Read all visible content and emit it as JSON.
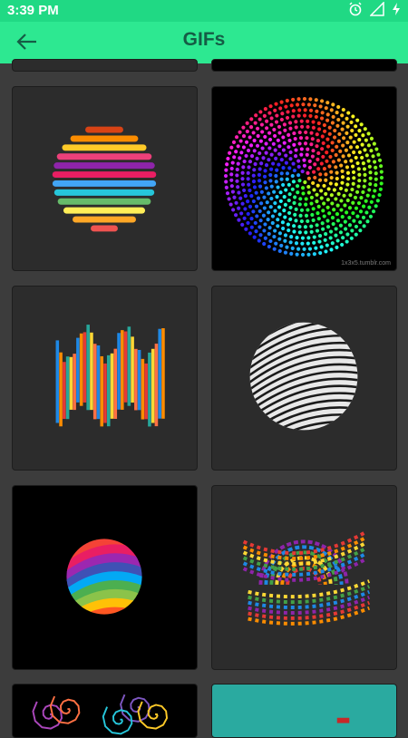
{
  "status_bar": {
    "time": "3:39 PM",
    "icons": [
      "alarm-icon",
      "signal-icon",
      "battery-charging-icon"
    ]
  },
  "app_bar": {
    "title": "GIFs",
    "back_icon": "arrow-left-icon"
  },
  "colors": {
    "status_bar": "#20d984",
    "app_bar": "#2de891",
    "background": "#3c3c3c",
    "card": "#2c2c2c",
    "title_text": "#155c45"
  },
  "gifs": [
    {
      "name": "striped-rainbow-sphere"
    },
    {
      "name": "rainbow-dot-spiral",
      "credit": "1x3x5.tumblr.com"
    },
    {
      "name": "rainbow-bar-wave"
    },
    {
      "name": "black-white-striped-sphere"
    },
    {
      "name": "rainbow-ribbon-ball"
    },
    {
      "name": "rainbow-arc-rings"
    },
    {
      "name": "fractal-tendrils"
    },
    {
      "name": "teal-panel"
    }
  ]
}
